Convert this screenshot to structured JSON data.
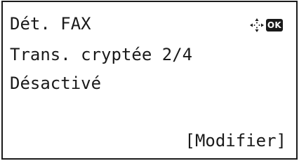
{
  "screen": {
    "title": "Dét. FAX",
    "setting_label": "Trans. cryptée 2/4",
    "setting_value": "Désactivé",
    "softkey_label": "[Modifier]"
  },
  "icons": {
    "navigation": "four-way-navigation-arrows-icon",
    "ok_key": "OK"
  },
  "colors": {
    "text": "#1a1a1a",
    "background": "#ffffff"
  }
}
